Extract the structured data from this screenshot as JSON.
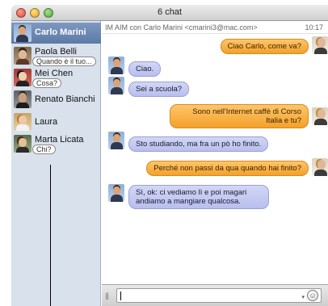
{
  "window": {
    "title": "6 chat"
  },
  "sidebar": {
    "buddies": [
      {
        "name": "Carlo Marini",
        "preview": "",
        "selected": true,
        "avatar": "carlo-avatar"
      },
      {
        "name": "Paola Belli",
        "preview": "Quando è il tuo...",
        "avatar": "paola-avatar"
      },
      {
        "name": "Mei Chen",
        "preview": "Cosa?",
        "avatar": "mei-avatar"
      },
      {
        "name": "Renato Bianchi",
        "preview": "",
        "avatar": "renato-avatar"
      },
      {
        "name": "Laura",
        "preview": "",
        "avatar": "laura-avatar"
      },
      {
        "name": "Marta Licata",
        "preview": "Chi?",
        "avatar": "marta-avatar"
      }
    ]
  },
  "chat": {
    "header": "IM AIM con Carlo Marini <cmarini3@mac.com>",
    "time": "10:17",
    "messages": [
      {
        "from": "me",
        "text": "Ciao Carlo, come va?"
      },
      {
        "from": "carlo",
        "text": "Ciao."
      },
      {
        "from": "carlo",
        "text": "Sei a scuola?"
      },
      {
        "from": "me",
        "text": "Sono nell'Internet caffè di Corso Italia e tu?"
      },
      {
        "from": "carlo",
        "text": "Sto studiando, ma fra un pò ho finito."
      },
      {
        "from": "me",
        "text": "Perché non passi da qua quando hai finito?"
      },
      {
        "from": "carlo",
        "text": "Sì, ok: ci vediamo lì e poi magari andiamo a mangiare qualcosa."
      }
    ]
  },
  "input": {
    "value": "",
    "emoticon_icon": "smiley-icon"
  },
  "colors": {
    "incoming_bubble": "#c3c9f2",
    "outgoing_bubble": "#f7ad3e",
    "sidebar": "#d8e1ec"
  }
}
